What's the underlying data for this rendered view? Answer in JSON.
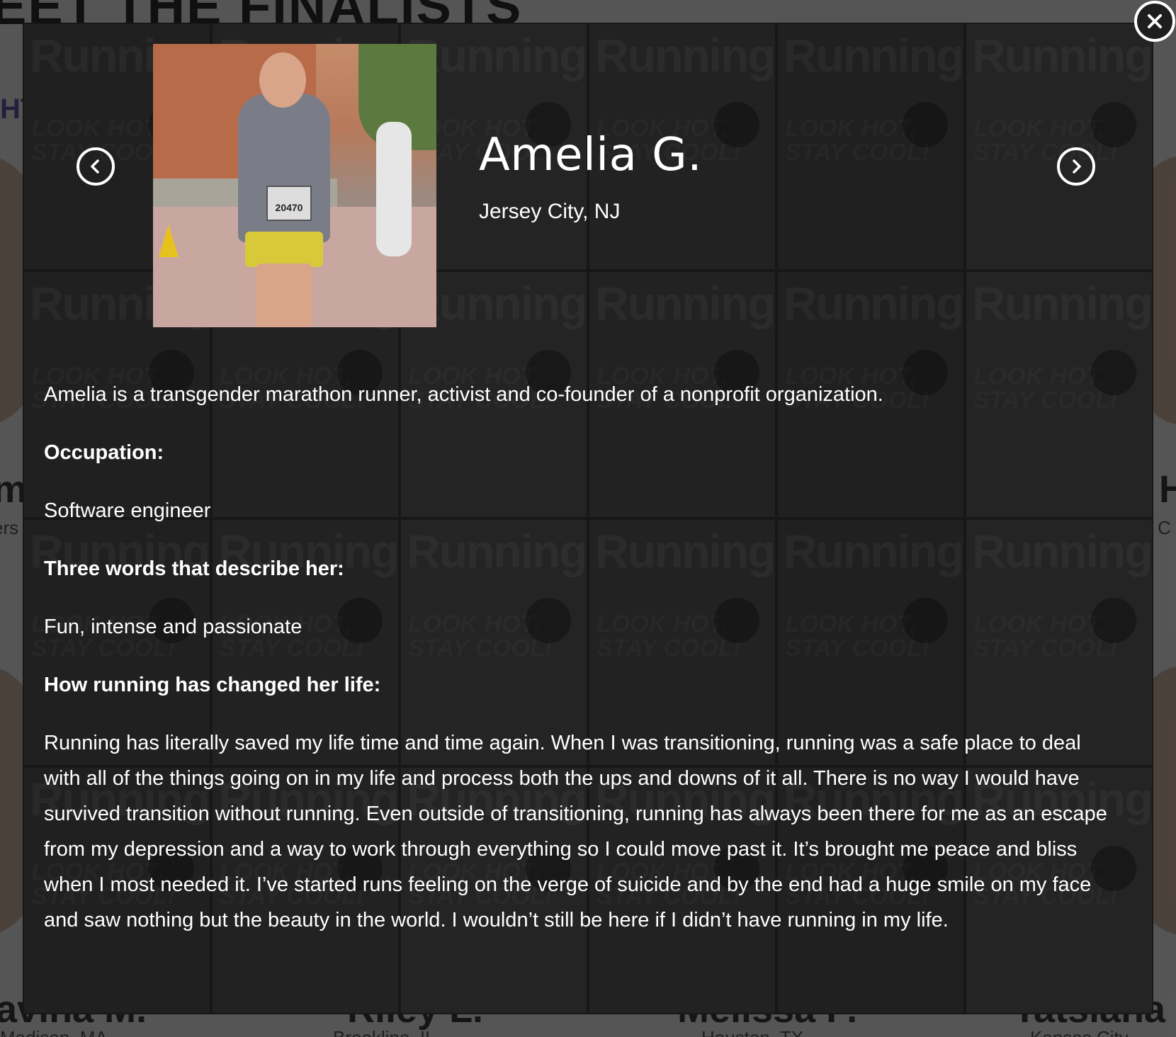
{
  "background": {
    "heading": "EET THE FINALISTS",
    "subheading": "HT",
    "finalists": [
      {
        "name": "m",
        "location": "ers"
      },
      {
        "name": "H",
        "location": "C"
      },
      {
        "name": "avina M.",
        "location": "Madison, MA"
      },
      {
        "name": "Riley L.",
        "location": "Brookline, IL"
      },
      {
        "name": "Melissa P.",
        "location": "Houston, TX"
      },
      {
        "name": "Tatsiana",
        "location": "Kansas City"
      }
    ],
    "cover_masthead": "Running",
    "cover_kicker": "LOOK HOT, STAY COOL!"
  },
  "profile": {
    "name": "Amelia G.",
    "location": "Jersey City, NJ",
    "photo_bib": "20470",
    "intro": "Amelia is a transgender marathon runner, activist and co-founder of a nonprofit organization.",
    "occupation_label": "Occupation:",
    "occupation": "Software engineer",
    "words_label": "Three words that describe her:",
    "words": "Fun, intense and passionate",
    "running_label": "How running has changed her life:",
    "running_text": "Running has literally saved my life time and time again. When I was transitioning, running was a safe place to deal with all of the things going on in my life and process both the ups and downs of it all. There is no way I would have survived transition without running. Even outside of transitioning, running has always been there for me as an escape from my depression and a way to work through everything so I could move past it. It’s brought me peace and bliss when I most needed it. I’ve started runs feeling on the verge of suicide and by the end had a huge smile on my face and saw nothing but the beauty in the world. I wouldn’t still be here if I didn’t have running in my life."
  },
  "controls": {
    "prev_icon": "chevron-left-icon",
    "next_icon": "chevron-right-icon",
    "close_icon": "close-icon"
  }
}
